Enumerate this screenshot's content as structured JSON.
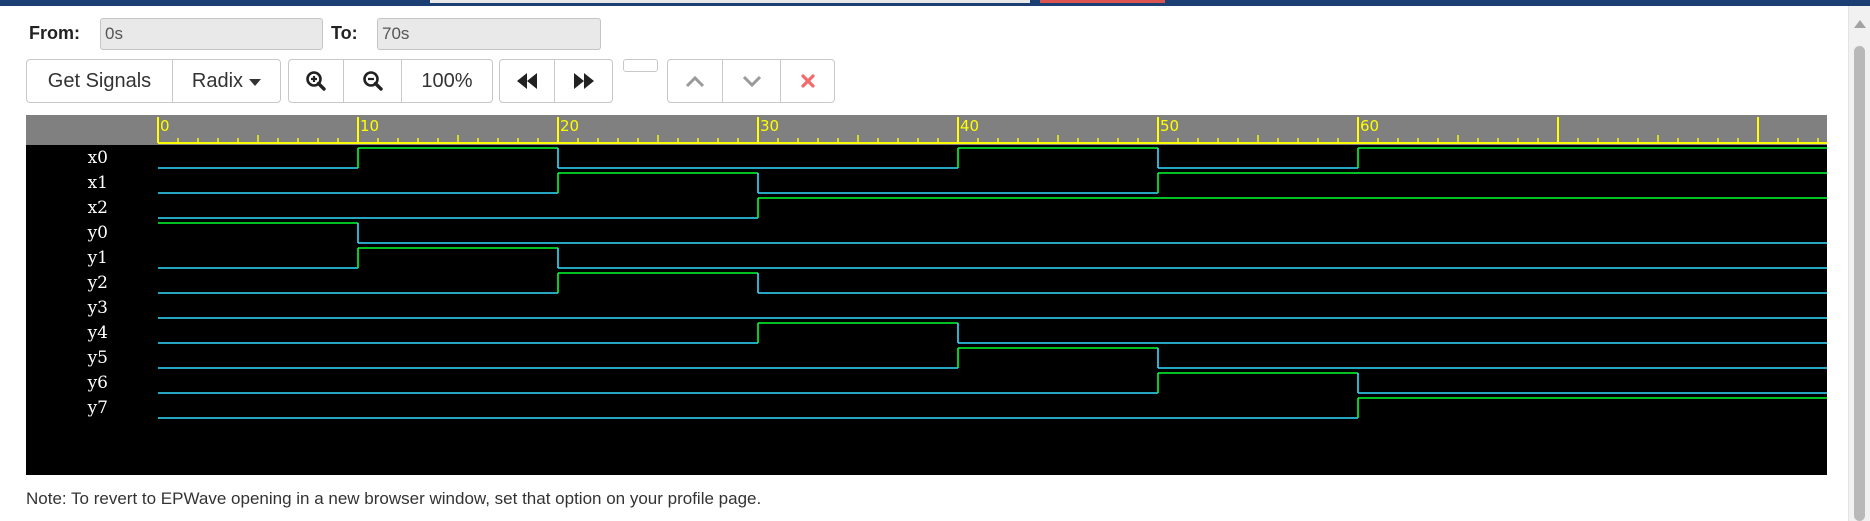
{
  "header": {
    "from_label": "From:",
    "from_value": "0s",
    "to_label": "To:",
    "to_value": "70s"
  },
  "toolbar": {
    "get_signals": "Get Signals",
    "radix": "Radix",
    "zoom": "100%"
  },
  "waveform": {
    "time_labels": [
      "0",
      "10",
      "20",
      "30",
      "40",
      "50",
      "60"
    ],
    "colors": {
      "high": "#00ff30",
      "low": "#33dcff",
      "ruler_bg": "#808080",
      "ruler_fg": "#ffff00",
      "close_x": "#f26a6a"
    },
    "signals": [
      {
        "name": "x0",
        "values": [
          0,
          1,
          0,
          0,
          1,
          0,
          1
        ]
      },
      {
        "name": "x1",
        "values": [
          0,
          0,
          1,
          0,
          0,
          1,
          1
        ]
      },
      {
        "name": "x2",
        "values": [
          0,
          0,
          0,
          1,
          1,
          1,
          1
        ]
      },
      {
        "name": "y0",
        "values": [
          1,
          0,
          0,
          0,
          0,
          0,
          0
        ]
      },
      {
        "name": "y1",
        "values": [
          0,
          1,
          0,
          0,
          0,
          0,
          0
        ]
      },
      {
        "name": "y2",
        "values": [
          0,
          0,
          1,
          0,
          0,
          0,
          0
        ]
      },
      {
        "name": "y3",
        "values": [
          0,
          0,
          0,
          0,
          0,
          0,
          0
        ]
      },
      {
        "name": "y4",
        "values": [
          0,
          0,
          0,
          1,
          0,
          0,
          0
        ]
      },
      {
        "name": "y5",
        "values": [
          0,
          0,
          0,
          0,
          1,
          0,
          0
        ]
      },
      {
        "name": "y6",
        "values": [
          0,
          0,
          0,
          0,
          0,
          1,
          0
        ]
      },
      {
        "name": "y7",
        "values": [
          0,
          0,
          0,
          0,
          0,
          0,
          1
        ]
      }
    ]
  },
  "note": "Note: To revert to EPWave opening in a new browser window, set that option on your profile page."
}
